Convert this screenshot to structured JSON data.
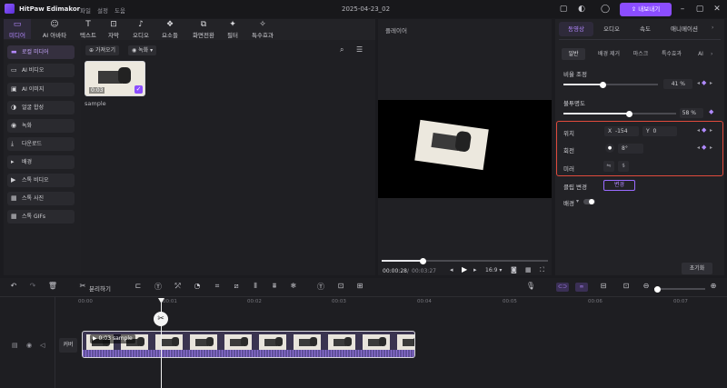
{
  "app": {
    "title": "HitPaw Edimakor",
    "menu": [
      "파일",
      "설정",
      "도움"
    ],
    "date": "2025-04-23_02",
    "export_label": "내보내기"
  },
  "colors": {
    "accent": "#8b4dff",
    "highlight_box": "#e04a3c"
  },
  "toolbar_tabs": [
    {
      "label": "미디어",
      "icon": "folder-icon"
    },
    {
      "label": "AI 아바타",
      "icon": "avatar-icon"
    },
    {
      "label": "텍스트",
      "icon": "text-icon"
    },
    {
      "label": "자막",
      "icon": "subtitle-icon"
    },
    {
      "label": "오디오",
      "icon": "music-icon"
    },
    {
      "label": "요소들",
      "icon": "elements-icon"
    },
    {
      "label": "화면전환",
      "icon": "transition-icon"
    },
    {
      "label": "필터",
      "icon": "filter-icon"
    },
    {
      "label": "특수효과",
      "icon": "effects-icon"
    }
  ],
  "sidebar": {
    "items": [
      "로컬 미디어",
      "AI 비디오",
      "AI 이미지",
      "얼굴 합성",
      "녹화",
      "다운로드",
      "배경",
      "스톡 비디오",
      "스톡 사진",
      "스톡 GIFs"
    ]
  },
  "media": {
    "import_label": "가져오기",
    "record_label": "녹화",
    "item": {
      "name": "sample",
      "duration": "0:03"
    }
  },
  "player": {
    "title": "플레이어",
    "current_time": "00:00:28",
    "total_time": "00:03:27",
    "ratio": "16:9",
    "progress": 0.19
  },
  "props": {
    "tabs": [
      "동영상",
      "오디오",
      "속도",
      "애니메이션"
    ],
    "subtabs": [
      "일반",
      "배경 제거",
      "마스크",
      "특수효과",
      "AI"
    ],
    "scale": {
      "label": "비율 조정",
      "value": "41",
      "unit": "%",
      "fraction": 0.41
    },
    "opacity": {
      "label": "불투명도",
      "value": "58",
      "unit": "%",
      "fraction": 0.58
    },
    "position": {
      "label": "위치",
      "x_label": "X",
      "x": "-154",
      "y_label": "Y",
      "y": "0"
    },
    "rotation": {
      "label": "회전",
      "value": "8°"
    },
    "mirror": {
      "label": "미러"
    },
    "clip_change": {
      "label": "클립 변경",
      "button": "변경"
    },
    "background": {
      "label": "배경"
    },
    "reset_label": "초기화"
  },
  "timeline": {
    "split_label": "분리하기",
    "ruler": [
      "00:00",
      "00:01",
      "00:02",
      "00:03",
      "00:04",
      "00:05",
      "00:06",
      "00:07"
    ],
    "track_label": "커버",
    "clip": {
      "duration": "0:03",
      "name": "sample"
    }
  }
}
